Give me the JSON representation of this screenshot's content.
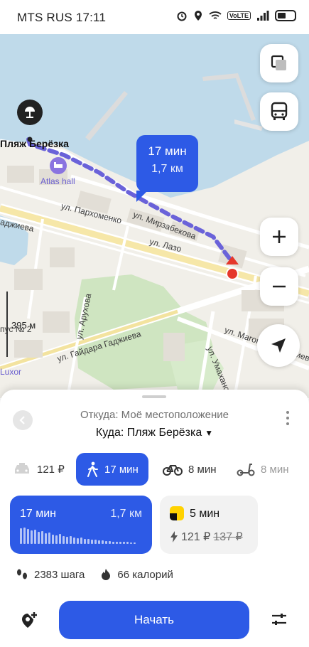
{
  "status_bar": {
    "carrier_time": "MTS RUS 17:11",
    "volte": "VoLTE"
  },
  "map": {
    "place_label": "Пляж Берёзка",
    "poi_label": "Atlas hall",
    "streets": {
      "parkhomenko": "ул. Пархоменко",
      "mirzabekova": "ул. Мирзабекова",
      "lazo": "ул. Лазо",
      "arukhova": "ул. Арухова",
      "gadzhieva": "ул. Гайдара Гаджиева",
      "magomed": "ул. Магомеда Гаджиева",
      "umakhanova": "ул. Умаханова",
      "left_gadzhieva": "аджиева",
      "luxor": "Luxor",
      "korpus": "пус № 2"
    },
    "scale_label": "395 м",
    "eta_bubble": {
      "time": "17 мин",
      "distance": "1,7 км"
    }
  },
  "sheet": {
    "from": "Откуда: Моё местоположение",
    "to": "Куда: Пляж Берёзка",
    "modes": [
      {
        "icon": "taxi-icon",
        "label": "121 ₽"
      },
      {
        "icon": "walk-icon",
        "label": "17 мин"
      },
      {
        "icon": "bicycle-icon",
        "label": "8 мин"
      },
      {
        "icon": "scooter-icon",
        "label": "8 мин"
      }
    ],
    "walk_card": {
      "time": "17 мин",
      "distance": "1,7 км"
    },
    "taxi_card": {
      "time": "5 мин",
      "price": "121 ₽",
      "old_price": "137 ₽"
    },
    "stats": {
      "steps": "2383 шага",
      "calories": "66 калорий"
    },
    "start_label": "Начать"
  },
  "colors": {
    "accent": "#2d5ae6",
    "route": "#6a62d9",
    "destination": "#e5372b"
  }
}
